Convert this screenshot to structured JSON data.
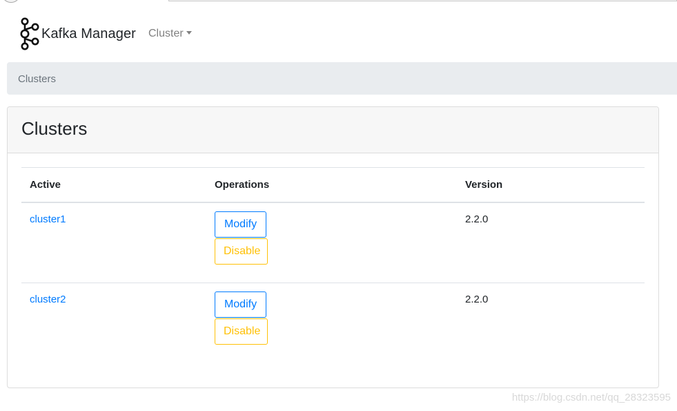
{
  "brand": {
    "name": "Kafka Manager",
    "logo_icon": "kafka-logo-icon"
  },
  "nav": {
    "cluster_menu": "Cluster"
  },
  "breadcrumb": {
    "current": "Clusters"
  },
  "card": {
    "title": "Clusters"
  },
  "table": {
    "headers": {
      "active": "Active",
      "operations": "Operations",
      "version": "Version"
    },
    "rows": [
      {
        "name": "cluster1",
        "modify": "Modify",
        "disable": "Disable",
        "version": "2.2.0"
      },
      {
        "name": "cluster2",
        "modify": "Modify",
        "disable": "Disable",
        "version": "2.2.0"
      }
    ]
  },
  "watermark": "https://blog.csdn.net/qq_28323595",
  "colors": {
    "link": "#007bff",
    "warning": "#ffc107",
    "breadcrumb_bg": "#e9ecef"
  }
}
